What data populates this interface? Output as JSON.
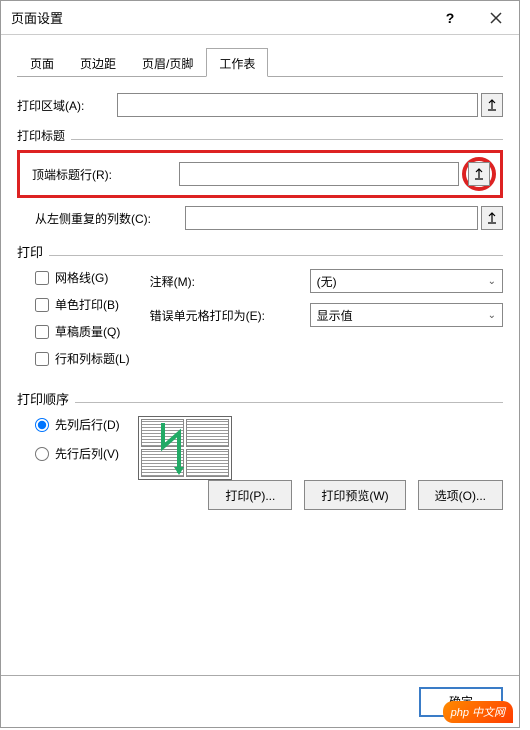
{
  "dialog": {
    "title": "页面设置"
  },
  "tabs": [
    {
      "label": "页面",
      "active": false
    },
    {
      "label": "页边距",
      "active": false
    },
    {
      "label": "页眉/页脚",
      "active": false
    },
    {
      "label": "工作表",
      "active": true
    }
  ],
  "form": {
    "print_area_label": "打印区域(A):",
    "print_area_value": "",
    "print_titles_header": "打印标题",
    "top_title_rows_label": "顶端标题行(R):",
    "top_title_rows_value": "",
    "left_repeat_cols_label": "从左侧重复的列数(C):",
    "left_repeat_cols_value": "",
    "print_header": "打印",
    "gridlines_label": "网格线(G)",
    "monochrome_label": "单色打印(B)",
    "draft_label": "草稿质量(Q)",
    "row_col_headings_label": "行和列标题(L)",
    "comments_label": "注释(M):",
    "comments_value": "(无)",
    "errors_label": "错误单元格打印为(E):",
    "errors_value": "显示值",
    "order_header": "打印顺序",
    "order_down_then_over_label": "先列后行(D)",
    "order_over_then_down_label": "先行后列(V)"
  },
  "buttons": {
    "print": "打印(P)...",
    "preview": "打印预览(W)",
    "options": "选项(O)...",
    "ok": "确定",
    "cancel_cutoff": ""
  },
  "watermark": "php 中文网"
}
